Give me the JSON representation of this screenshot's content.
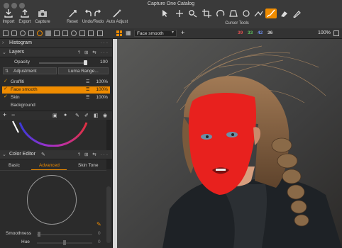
{
  "window": {
    "title": "Capture One Catalog"
  },
  "toolbar": {
    "import": "Import",
    "export": "Export",
    "capture": "Capture",
    "reset": "Reset",
    "undo_redo": "Undo/Redo",
    "auto_adjust": "Auto Adjust",
    "cursor_tools": "Cursor Tools"
  },
  "viewer": {
    "layer_select": "Face smooth",
    "counts": [
      "39",
      "33",
      "42",
      "36"
    ],
    "count_colors": [
      "#e05050",
      "#5fc45f",
      "#6f8ff0",
      "#cfcfcf"
    ],
    "zoom": "100%"
  },
  "histogram": {
    "title": "Histogram"
  },
  "layers": {
    "title": "Layers",
    "opacity_label": "Opacity",
    "opacity_value": "100",
    "adjustment_label": "Adjustment",
    "luma_range": "Luma Range...",
    "items": [
      {
        "name": "Graffiti",
        "percent": "100%"
      },
      {
        "name": "Face smooth",
        "percent": "100%"
      },
      {
        "name": "Skin",
        "percent": "100%"
      },
      {
        "name": "Background",
        "percent": ""
      }
    ]
  },
  "color_editor": {
    "title": "Color Editor",
    "tabs": [
      "Basic",
      "Advanced",
      "Skin Tone"
    ],
    "smoothness_label": "Smoothness",
    "smoothness_value": "0",
    "hue_label": "Hue",
    "hue_value": "0"
  },
  "colors": {
    "accent": "#f08c00",
    "mask_red": "#e8211e"
  }
}
